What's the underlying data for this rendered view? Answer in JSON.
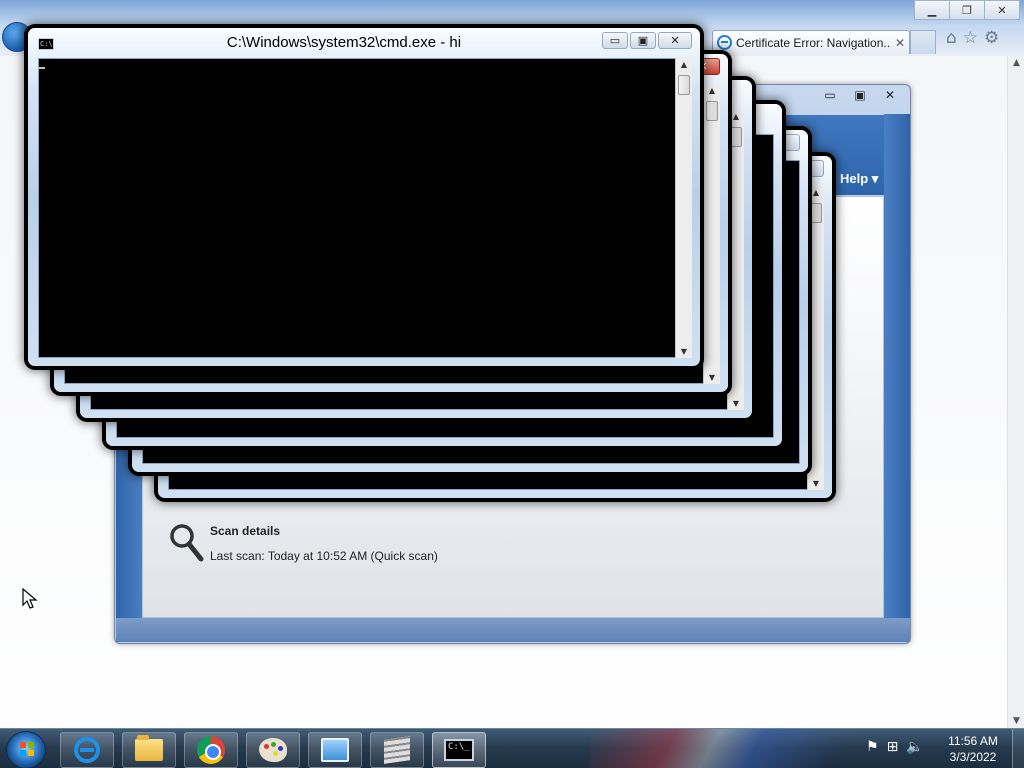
{
  "browser": {
    "tab_title": "Certificate Error: Navigation...",
    "tab_close": "✕",
    "icons": [
      "home-icon",
      "favorites-star-icon",
      "tools-gear-icon"
    ],
    "icon_glyphs": {
      "home": "⌂",
      "star": "☆",
      "gear": "⚙"
    },
    "caption": {
      "minimize": "▁",
      "maximize": "❐",
      "close": "✕"
    },
    "scroll_up": "▲",
    "scroll_down": "▼"
  },
  "app": {
    "caption": {
      "minimize": "▭",
      "maximize": "▣",
      "close": "✕"
    },
    "help_label": "Help ▾",
    "scan_details_title": "Scan details",
    "last_scan": "Last scan:  Today at 10:52 AM (Quick scan)"
  },
  "cmd": {
    "title": "C:\\Windows\\system32\\cmd.exe - hi",
    "icon_text": "C:\\",
    "caption": {
      "minimize": "▭",
      "maximize": "▣",
      "close": "✕"
    },
    "scroll_up": "▲",
    "scroll_down": "▼"
  },
  "taskbar": {
    "pinned": [
      {
        "name": "internet-explorer",
        "icon": "internet-explorer-icon"
      },
      {
        "name": "windows-explorer",
        "icon": "folder-icon"
      },
      {
        "name": "google-chrome",
        "icon": "chrome-icon"
      },
      {
        "name": "paint",
        "icon": "paint-palette-icon"
      },
      {
        "name": "remote-desktop",
        "icon": "monitor-icon"
      },
      {
        "name": "firewall",
        "icon": "brick-wall-icon"
      },
      {
        "name": "command-prompt",
        "icon": "cmd-icon",
        "active": true
      }
    ],
    "cmd_icon_text": "C:\\_",
    "tray": {
      "flag": "⚑",
      "network": "⊞",
      "volume": "🔈"
    },
    "time": "11:56 AM",
    "date": "3/3/2022"
  },
  "colors": {
    "cmd_client": "#000000",
    "app_header": "#2e64ab",
    "taskbar": "#26394d",
    "close_red": "#c7402b"
  }
}
